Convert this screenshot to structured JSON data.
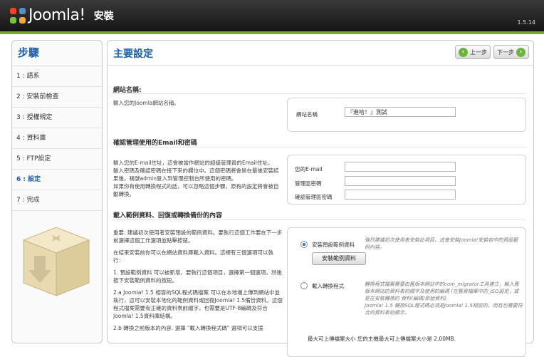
{
  "header": {
    "brand": "Joomla!",
    "title": "安裝",
    "version": "1.5.14"
  },
  "sidebar": {
    "title": "步驟",
    "steps": [
      {
        "label": "1 : 語系"
      },
      {
        "label": "2 : 安裝前檢查"
      },
      {
        "label": "3 : 授權規定"
      },
      {
        "label": "4 : 資料庫"
      },
      {
        "label": "5 : FTP設定"
      },
      {
        "label": "6 : 設定"
      },
      {
        "label": "7 : 完成"
      }
    ]
  },
  "main": {
    "title": "主要設定",
    "prev_label": "上一步",
    "next_label": "下一步",
    "site_name": {
      "heading": "網站名稱:",
      "desc": "輸入您的Joomla網站名稱。",
      "field_label": "網站名稱",
      "field_value": "『進哈！』測試"
    },
    "admin": {
      "heading": "確認管理使用的Email和密碼",
      "desc_1": "輸入您的E-mail住址，這會被當作網站的超級管理員的Email住址。",
      "desc_2": "輸入密碼及確認密碼在接下來的欄位中。這個密碼將會是在最後安裝結果後，稱號admin登入到管理控制台所使用的密碼。",
      "desc_3": "如果你有使用轉換程式的話，可以忽略這個步驟，原有的設定將會被自動轉換。",
      "email_label": "您的E-mail",
      "password_label": "管理區密碼",
      "confirm_label": "確認管理區密碼"
    },
    "sample": {
      "heading": "載入範例資料、回復或轉換備份的內容",
      "p1": "重要: 建議初次使用者安裝預設的範例資料。要執行這個工作要在下一步前選擇這個工作選項並點擊按鈕。",
      "p2": "在結束安裝前你可以在網站資料庫載入資料。這裡有三個選項可以執行：",
      "p3": "1. 預設範例資料 可以被新增，要執行這個項目，選擇第一個選項，然後按下安裝範例資料的按鈕。",
      "p4": "2.a Joomla! 1.5 相容的SQL程式碼檔案 可以在本地端上傳到網站中並執行，這可以安裝本地化的範例資料或回復Joomla! 1.5備份資料。這個程式檔案需要有正確的資料表前綴字，也需要是UTF-8編碼及符合Joomla! 1.5資料庫結構。",
      "p5": "2.b 轉換之前版本的內容. 選擇 \"載入轉換程式碼\" 選項可以支援",
      "option1_label": "安裝預設範例資料",
      "option1_desc": "強烈建議初次使用者安裝此項目，這會安裝Joomla!安裝包中的預設範例內容。",
      "install_button": "安裝範例資料",
      "option2_label": "載入轉換程式",
      "option2_desc_1": "轉換程式檔案需要由舊版本網站中的com_migrator工具建立，輸入舊版本網站的資料表前綴字及使用的編碼 (在舊資檔案中的_ISO設定，或是在安裝轉換的 資料(編碼/原始資料)",
      "option2_desc_2": "Joomla! 1.5 轉換SQL程式碼必須是Joomla! 1.5相容的，而且也需要符合的資料表前綴字。",
      "max_upload": "最大可上傳檔案大小  您的主機最大可上傳檔案大小是 2.00MB."
    }
  }
}
